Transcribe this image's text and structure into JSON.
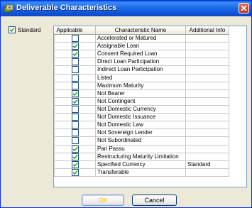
{
  "window": {
    "title": "Deliverable Characteristics"
  },
  "standard": {
    "label": "Standard",
    "checked": true
  },
  "columns": {
    "applicable": "Applicable",
    "name": "Characteristic Name",
    "info": "Additional Info"
  },
  "rows": [
    {
      "applicable": false,
      "name": "Accelerated or Matured",
      "info": ""
    },
    {
      "applicable": true,
      "name": "Assignable Loan",
      "info": ""
    },
    {
      "applicable": true,
      "name": "Consent Required Loan",
      "info": ""
    },
    {
      "applicable": false,
      "name": "Direct Loan Participation",
      "info": ""
    },
    {
      "applicable": false,
      "name": "Indirect Loan Participation",
      "info": ""
    },
    {
      "applicable": false,
      "name": "Listed",
      "info": ""
    },
    {
      "applicable": false,
      "name": "Maximum Maturity",
      "info": ""
    },
    {
      "applicable": true,
      "name": "Not Bearer",
      "info": ""
    },
    {
      "applicable": true,
      "name": "Not Contingent",
      "info": ""
    },
    {
      "applicable": false,
      "name": "Not Domestic Currency",
      "info": ""
    },
    {
      "applicable": false,
      "name": "Not Domestic Issuance",
      "info": ""
    },
    {
      "applicable": false,
      "name": "Not Domestic Law",
      "info": ""
    },
    {
      "applicable": false,
      "name": "Not Sovereign Lender",
      "info": ""
    },
    {
      "applicable": false,
      "name": "Not Subordinated",
      "info": ""
    },
    {
      "applicable": true,
      "name": "Pari Passu",
      "info": ""
    },
    {
      "applicable": true,
      "name": "Restructuring Maturity Limitation",
      "info": ""
    },
    {
      "applicable": true,
      "name": "Specified Currency",
      "info": "Standard"
    },
    {
      "applicable": true,
      "name": "Transferable",
      "info": ""
    }
  ],
  "buttons": {
    "ok": "OK",
    "cancel": "Cancel"
  },
  "colors": {
    "check": "#21a121",
    "titlebar": "#0a5fe4"
  }
}
